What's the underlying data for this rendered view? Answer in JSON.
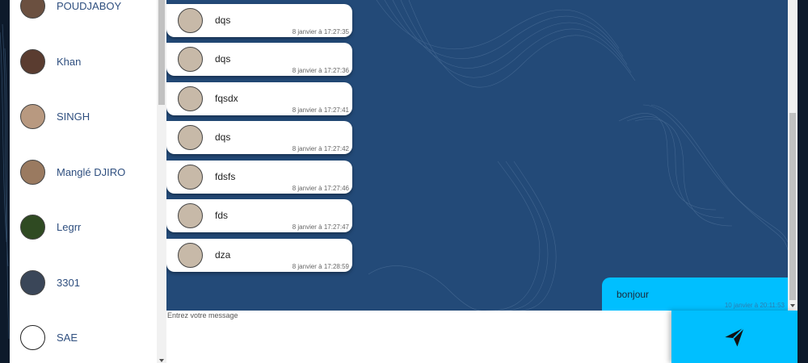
{
  "contacts": [
    {
      "name": "POUDJABOY"
    },
    {
      "name": "Khan"
    },
    {
      "name": "SINGH"
    },
    {
      "name": "Manglé DJIRO"
    },
    {
      "name": "Legrr"
    },
    {
      "name": "3301"
    },
    {
      "name": "SAE"
    }
  ],
  "messages": [
    {
      "text": "dqs",
      "time": "8 janvier à 17:27:35"
    },
    {
      "text": "dqs",
      "time": "8 janvier à 17:27:36"
    },
    {
      "text": "fqsdx",
      "time": "8 janvier à 17:27:41"
    },
    {
      "text": "dqs",
      "time": "8 janvier à 17:27:42"
    },
    {
      "text": "fdsfs",
      "time": "8 janvier à 17:27:46"
    },
    {
      "text": "fds",
      "time": "8 janvier à 17:27:47"
    },
    {
      "text": "dza",
      "time": "8 janvier à 17:28:59"
    }
  ],
  "my_message": {
    "text": "bonjour",
    "time": "10 janvier à 20:11:53"
  },
  "composer": {
    "placeholder": "Entrez votre message"
  },
  "send_icon": "send-icon",
  "colors": {
    "chat_bg": "#234a78",
    "accent": "#00bfff",
    "page_bg": "#0d1a2b"
  }
}
